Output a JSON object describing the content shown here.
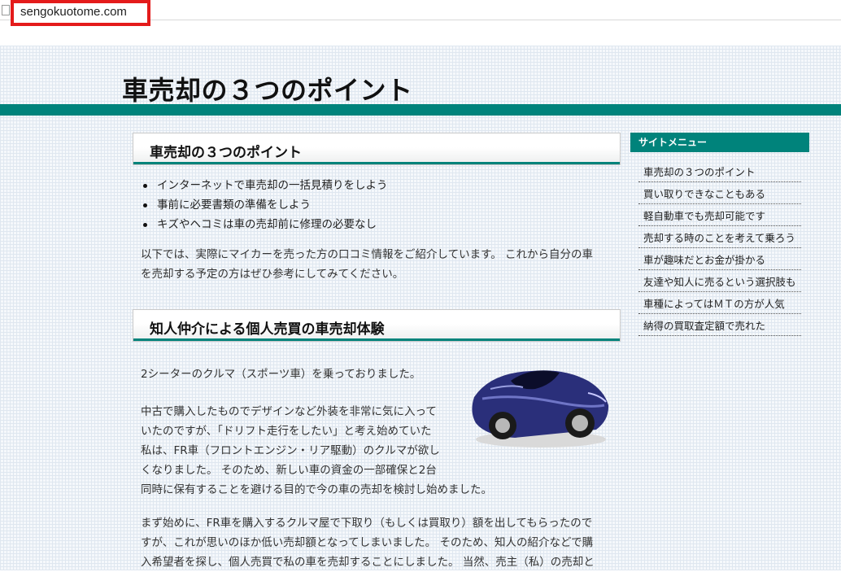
{
  "browser": {
    "url": "sengokuotome.com"
  },
  "site": {
    "title": "車売却の３つのポイント"
  },
  "main": {
    "section1": {
      "heading": "車売却の３つのポイント",
      "bullets": [
        "インターネットで車売却の一括見積りをしよう",
        "事前に必要書類の準備をしよう",
        "キズやヘコミは車の売却前に修理の必要なし"
      ],
      "intro_line1": "以下では、実際にマイカーを売った方の口コミ情報をご紹介しています。 これから自分の車",
      "intro_line2": "を売却する予定の方はぜひ参考にしてみてください。"
    },
    "section2": {
      "heading": "知人仲介による個人売買の車売却体験",
      "p1": "2シーターのクルマ（スポーツ車）を乗っておりました。",
      "p2_lines": [
        "中古で購入したものでデザインなど外装を非常に気に入って",
        "いたのですが、「ドリフト走行をしたい」と考え始めていた",
        "私は、FR車（フロントエンジン・リア駆動）のクルマが欲し",
        "くなりました。 そのため、新しい車の資金の一部確保と2台",
        "同時に保有することを避ける目的で今の車の売却を検討し始めました。"
      ],
      "p3_lines": [
        "まず始めに、FR車を購入するクルマ屋で下取り（もしくは買取り）額を出してもらったので",
        "すが、これが思いのほか低い売却額となってしまいました。 そのため、知人の紹介などで購",
        "入希望者を探し、個人売買で私の車を売却することにしました。 当然、売主（私）の売却と"
      ]
    }
  },
  "sidebar": {
    "title": "サイトメニュー",
    "items": [
      "車売却の３つのポイント",
      "買い取りできなこともある",
      "軽自動車でも売却可能です",
      "売却する時のことを考えて乗ろう",
      "車が趣味だとお金が掛かる",
      "友達や知人に売るという選択肢も",
      "車種によってはＭＴの方が人気",
      "納得の買取査定額で売れた"
    ]
  },
  "colors": {
    "accent": "#00837b",
    "highlight": "#e41b1b"
  }
}
